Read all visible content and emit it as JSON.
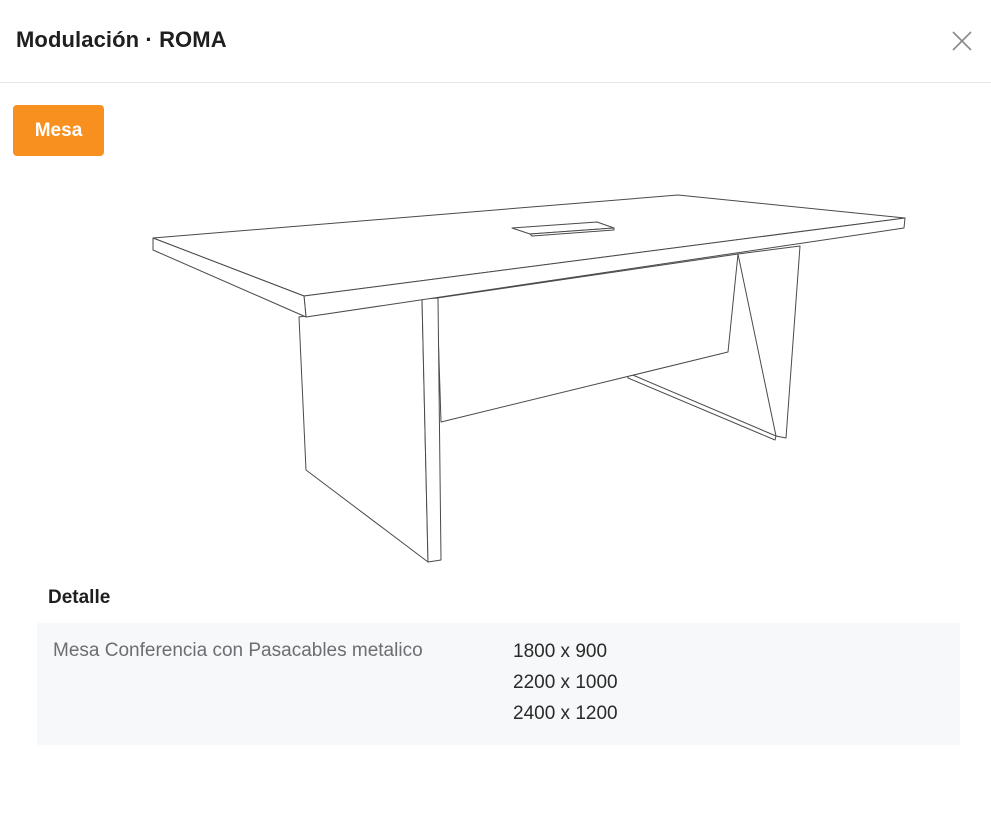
{
  "modal": {
    "title": "Modulación · ROMA",
    "close_icon": "close-icon"
  },
  "tabs": [
    {
      "label": "Mesa",
      "active": true,
      "color": "#f7901e"
    }
  ],
  "detail": {
    "heading": "Detalle",
    "product_name": "Mesa Conferencia con Pasacables metalico",
    "sizes": [
      "1800 x 900",
      "2200 x 1000",
      "2400 x 1200"
    ]
  },
  "figure": {
    "subject": "conference-table-line-drawing"
  }
}
